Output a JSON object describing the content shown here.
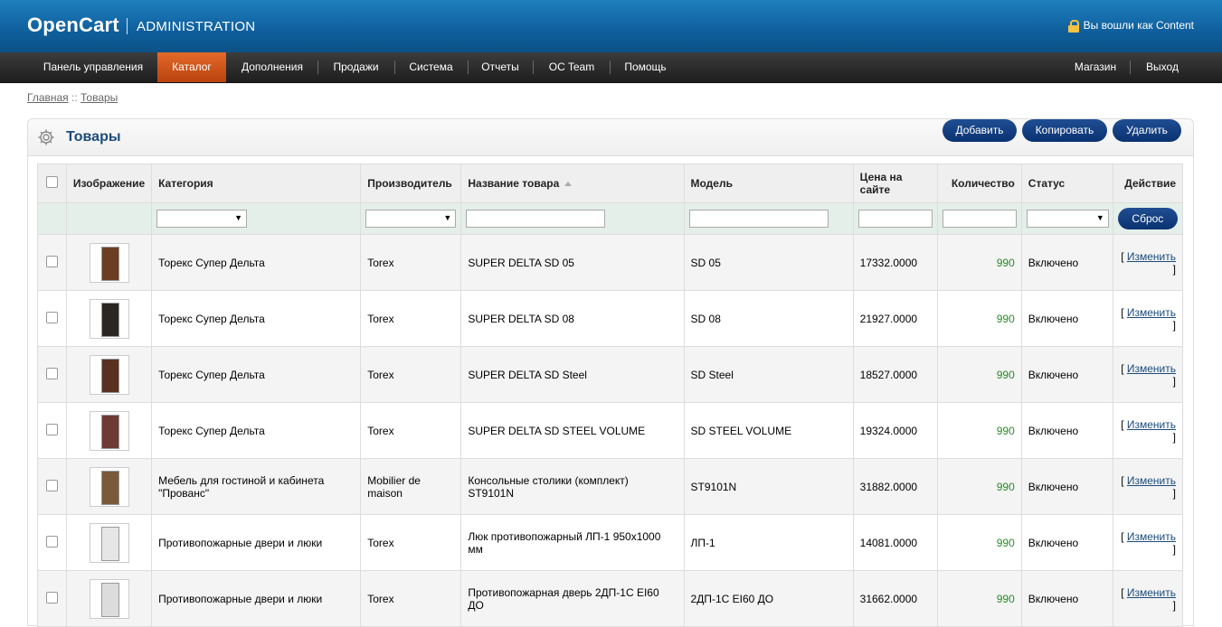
{
  "header": {
    "logo": "OpenCart",
    "subtitle": "ADMINISTRATION",
    "login_text": "Вы вошли как Content"
  },
  "menu": {
    "left": [
      "Панель управления",
      "Каталог",
      "Дополнения",
      "Продажи",
      "Система",
      "Отчеты",
      "OC Team",
      "Помощь"
    ],
    "right": [
      "Магазин",
      "Выход"
    ],
    "active": "Каталог"
  },
  "breadcrumb": {
    "home": "Главная",
    "separator": " :: ",
    "current": "Товары"
  },
  "box": {
    "title": "Товары",
    "buttons": {
      "add": "Добавить",
      "copy": "Копировать",
      "delete": "Удалить"
    }
  },
  "table": {
    "columns": {
      "image": "Изображение",
      "category": "Категория",
      "manufacturer": "Производитель",
      "name": "Название товара",
      "model": "Модель",
      "price": "Цена на сайте",
      "quantity": "Количество",
      "status": "Статус",
      "action": "Действие"
    },
    "filter_button": "Сброс",
    "action_link": "Изменить",
    "rows": [
      {
        "category": "Торекс Супер Дельта",
        "manufacturer": "Torex",
        "name": "SUPER DELTA SD 05",
        "model": "SD 05",
        "price": "17332.0000",
        "quantity": "990",
        "status": "Включено",
        "thumb_color": "#6b3d22"
      },
      {
        "category": "Торекс Супер Дельта",
        "manufacturer": "Torex",
        "name": "SUPER DELTA SD 08",
        "model": "SD 08",
        "price": "21927.0000",
        "quantity": "990",
        "status": "Включено",
        "thumb_color": "#2b2622"
      },
      {
        "category": "Торекс Супер Дельта",
        "manufacturer": "Torex",
        "name": "SUPER DELTA SD Steel",
        "model": "SD Steel",
        "price": "18527.0000",
        "quantity": "990",
        "status": "Включено",
        "thumb_color": "#5a3020"
      },
      {
        "category": "Торекс Супер Дельта",
        "manufacturer": "Torex",
        "name": "SUPER DELTA SD STEEL VOLUME",
        "model": "SD STEEL VOLUME",
        "price": "19324.0000",
        "quantity": "990",
        "status": "Включено",
        "thumb_color": "#6e3a34"
      },
      {
        "category": "Мебель для гостиной и кабинета \"Прованс\"",
        "manufacturer": "Mobilier de maison",
        "name": "Консольные столики (комплект) ST9101N",
        "model": "ST9101N",
        "price": "31882.0000",
        "quantity": "990",
        "status": "Включено",
        "thumb_color": "#7a5a3a"
      },
      {
        "category": "Противопожарные двери и люки",
        "manufacturer": "Torex",
        "name": "Люк противопожарный ЛП-1 950х1000 мм",
        "model": "ЛП-1",
        "price": "14081.0000",
        "quantity": "990",
        "status": "Включено",
        "thumb_color": "#e6e6e6"
      },
      {
        "category": "Противопожарные двери и люки",
        "manufacturer": "Torex",
        "name": "Противопожарная дверь 2ДП-1С EI60 ДО",
        "model": "2ДП-1С EI60 ДО",
        "price": "31662.0000",
        "quantity": "990",
        "status": "Включено",
        "thumb_color": "#dcdcdc"
      }
    ]
  }
}
